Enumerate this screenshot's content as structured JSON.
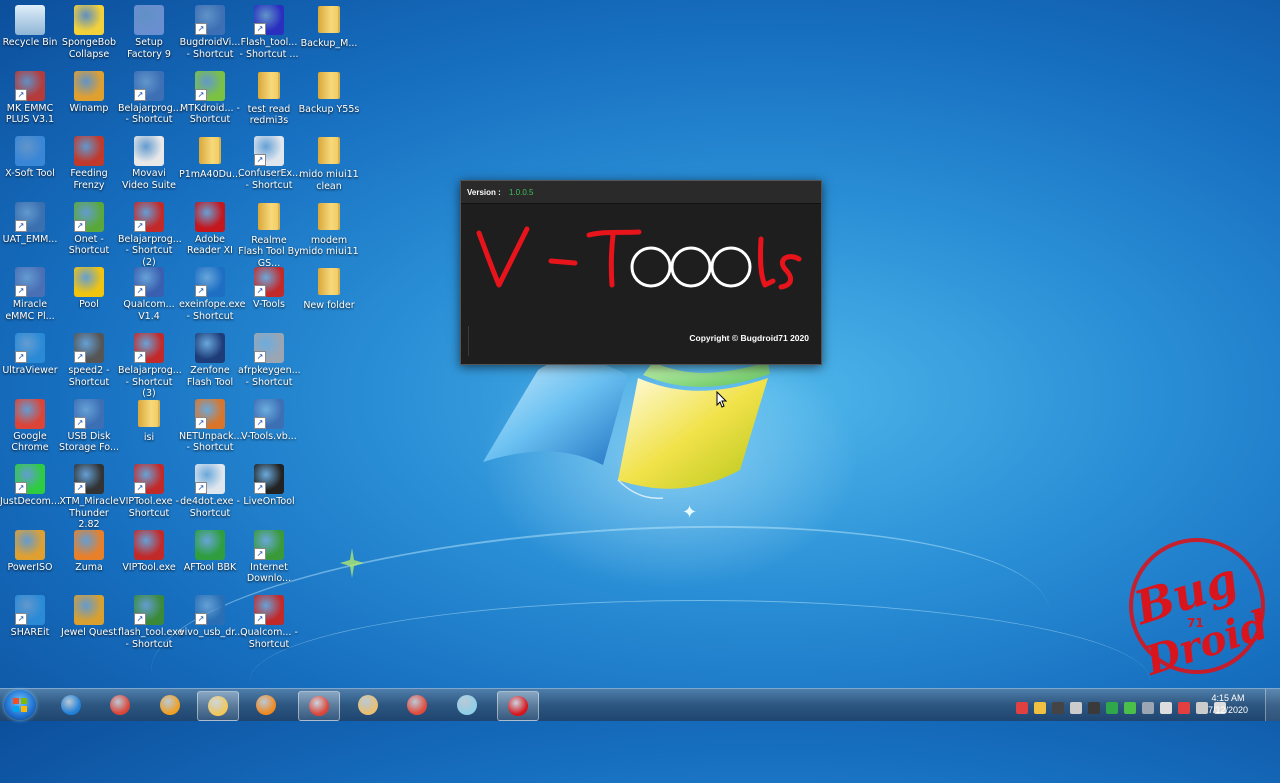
{
  "desktop_icons": [
    {
      "label": "Recycle Bin",
      "icon": "recycle-bin-icon",
      "kind": "bin",
      "color": "#8fb5d6"
    },
    {
      "label": "SpongeBob Collapse",
      "icon": "spongebob-icon",
      "kind": "app",
      "color": "#f3d13a"
    },
    {
      "label": "Setup Factory 9",
      "icon": "setup-factory-icon",
      "kind": "app",
      "color": "#6a8fd0"
    },
    {
      "label": "BugdroidVi... - Shortcut",
      "icon": "vb-project-icon",
      "kind": "shortcut",
      "color": "#3d6fb5"
    },
    {
      "label": "Flash_tool... - Shortcut ...",
      "icon": "flash-tool-icon",
      "kind": "shortcut",
      "color": "#2a2fbf"
    },
    {
      "label": "Backup_M...",
      "icon": "folder-icon",
      "kind": "folder"
    },
    {
      "label": "MK EMMC PLUS V3.1",
      "icon": "mk-emmc-icon",
      "kind": "shortcut",
      "color": "#b53a3a"
    },
    {
      "label": "Winamp",
      "icon": "winamp-icon",
      "kind": "app",
      "color": "#e0a030"
    },
    {
      "label": "Belajarprog... - Shortcut",
      "icon": "vb-project-icon",
      "kind": "shortcut",
      "color": "#3d6fb5"
    },
    {
      "label": "MTKdroid... - Shortcut",
      "icon": "android-icon",
      "kind": "shortcut",
      "color": "#7cc242"
    },
    {
      "label": "test read redmi3s",
      "icon": "folder-icon",
      "kind": "folder"
    },
    {
      "label": "Backup Y55s",
      "icon": "folder-icon",
      "kind": "folder"
    },
    {
      "label": "X-Soft Tool",
      "icon": "gear-icon",
      "kind": "app",
      "color": "#3a86d6"
    },
    {
      "label": "Feeding Frenzy",
      "icon": "fish-icon",
      "kind": "app",
      "color": "#c0392b"
    },
    {
      "label": "Movavi Video Suite",
      "icon": "movavi-icon",
      "kind": "app",
      "color": "#e8e8e8"
    },
    {
      "label": "P1mA40Du...",
      "icon": "folder-icon",
      "kind": "folder"
    },
    {
      "label": "ConfuserEx... - Shortcut",
      "icon": "confuser-icon",
      "kind": "shortcut",
      "color": "#dfe6ee"
    },
    {
      "label": "mido miui11 clean",
      "icon": "folder-icon",
      "kind": "folder"
    },
    {
      "label": "UAT_EMM...",
      "icon": "uat-emmc-icon",
      "kind": "shortcut",
      "color": "#3a6fb0"
    },
    {
      "label": "Onet - Shortcut",
      "icon": "onet-icon",
      "kind": "shortcut",
      "color": "#5aa83c"
    },
    {
      "label": "Belajarprog... - Shortcut (2)",
      "icon": "bug-icon",
      "kind": "shortcut",
      "color": "#c22a2a"
    },
    {
      "label": "Adobe Reader XI",
      "icon": "adobe-reader-icon",
      "kind": "app",
      "color": "#c4161c"
    },
    {
      "label": "Realme Flash Tool By GS...",
      "icon": "folder-icon",
      "kind": "folder"
    },
    {
      "label": "modem mido miui11",
      "icon": "folder-icon",
      "kind": "folder"
    },
    {
      "label": "Miracle eMMC Pl...",
      "icon": "miracle-icon",
      "kind": "shortcut",
      "color": "#4a6fb5"
    },
    {
      "label": "Pool",
      "icon": "pool-ball-icon",
      "kind": "app",
      "color": "#f1c40f"
    },
    {
      "label": "Qualcom... V1.4",
      "icon": "qualcomm-icon",
      "kind": "shortcut",
      "color": "#3a5fb0"
    },
    {
      "label": "exeinfope.exe - Shortcut",
      "icon": "exeinfo-icon",
      "kind": "shortcut",
      "color": "#1e6fc4"
    },
    {
      "label": "V-Tools",
      "icon": "bug-icon",
      "kind": "shortcut",
      "color": "#c22a2a"
    },
    {
      "label": "New folder",
      "icon": "folder-icon",
      "kind": "folder"
    },
    {
      "label": "UltraViewer",
      "icon": "ultraviewer-icon",
      "kind": "shortcut",
      "color": "#2a8ad6"
    },
    {
      "label": "speed2 - Shortcut",
      "icon": "speed-icon",
      "kind": "shortcut",
      "color": "#555555"
    },
    {
      "label": "Belajarprog... - Shortcut (3)",
      "icon": "bug-icon",
      "kind": "shortcut",
      "color": "#c22a2a"
    },
    {
      "label": "Zenfone Flash Tool",
      "icon": "zenfone-icon",
      "kind": "app",
      "color": "#1e3c78"
    },
    {
      "label": "afrpkeygen... - Shortcut",
      "icon": "tools-icon",
      "kind": "shortcut",
      "color": "#9aa6b4"
    },
    null,
    {
      "label": "Google Chrome",
      "icon": "chrome-icon",
      "kind": "app",
      "color": "#db4437"
    },
    {
      "label": "USB Disk Storage Fo...",
      "icon": "usb-icon",
      "kind": "shortcut",
      "color": "#3d6fb5"
    },
    {
      "label": "isi",
      "icon": "folder-icon",
      "kind": "folder"
    },
    {
      "label": "NETUnpack... - Shortcut",
      "icon": "netunpack-icon",
      "kind": "shortcut",
      "color": "#d8752a"
    },
    {
      "label": "V-Tools.vb...",
      "icon": "vb-project-icon",
      "kind": "shortcut",
      "color": "#3d6fb5"
    },
    null,
    {
      "label": "JustDecom...",
      "icon": "justdecompile-icon",
      "kind": "shortcut",
      "color": "#2ecc40"
    },
    {
      "label": "XTM_Miracle Thunder 2.82",
      "icon": "thunder-icon",
      "kind": "shortcut",
      "color": "#333333"
    },
    {
      "label": "VIPTool.exe - Shortcut",
      "icon": "bug-icon",
      "kind": "shortcut",
      "color": "#c22a2a"
    },
    {
      "label": "de4dot.exe - Shortcut",
      "icon": "de4dot-icon",
      "kind": "shortcut",
      "color": "#dfe6ee"
    },
    {
      "label": "LiveOnTool",
      "icon": "liveon-icon",
      "kind": "shortcut",
      "color": "#222222"
    },
    null,
    {
      "label": "PowerISO",
      "icon": "poweriso-icon",
      "kind": "app",
      "color": "#e0a030"
    },
    {
      "label": "Zuma",
      "icon": "zuma-icon",
      "kind": "app",
      "color": "#e8802a"
    },
    {
      "label": "VIPTool.exe",
      "icon": "bug-icon",
      "kind": "app",
      "color": "#c22a2a"
    },
    {
      "label": "AFTool BBK",
      "icon": "aftool-icon",
      "kind": "app",
      "color": "#2e9e3e"
    },
    {
      "label": "Internet Downlo...",
      "icon": "idm-icon",
      "kind": "shortcut",
      "color": "#3a9a3a"
    },
    null,
    {
      "label": "SHAREit",
      "icon": "shareit-icon",
      "kind": "shortcut",
      "color": "#2a8ad6"
    },
    {
      "label": "Jewel Quest",
      "icon": "jewel-quest-icon",
      "kind": "app",
      "color": "#d9a030"
    },
    {
      "label": "flash_tool.exe - Shortcut",
      "icon": "flash-tool-exe-icon",
      "kind": "shortcut",
      "color": "#3a8a3a"
    },
    {
      "label": "vivo_usb_dr...",
      "icon": "vivo-usb-icon",
      "kind": "shortcut",
      "color": "#2a6fb5"
    },
    {
      "label": "Qualcom... - Shortcut",
      "icon": "bug-icon",
      "kind": "shortcut",
      "color": "#c22a2a"
    }
  ],
  "splash": {
    "version_label": "Version :",
    "version_value": "1.0.0.5",
    "logo_text": "V-TOOLs",
    "copyright": "Copyright © Bugdroid71 2020"
  },
  "watermark": {
    "text": "Bug Droid",
    "small": "71",
    "color": "#d8141c"
  },
  "taskbar": {
    "pinned": [
      {
        "name": "internet-explorer-icon",
        "color": "#1f7fd6",
        "active": false
      },
      {
        "name": "chrome-icon",
        "color": "#db4437",
        "active": false
      },
      {
        "name": "sublime-icon",
        "color": "#f0a020",
        "active": false
      },
      {
        "name": "explorer-folder-icon",
        "color": "#f2c85a",
        "active": true
      },
      {
        "name": "media-player-icon",
        "color": "#f08a20",
        "active": false
      },
      {
        "name": "chrome-icon",
        "color": "#db4437",
        "active": true
      },
      {
        "name": "paint-icon",
        "color": "#e8c070",
        "active": false
      },
      {
        "name": "movavi-icon",
        "color": "#e34a3a",
        "active": false
      },
      {
        "name": "eraser-icon",
        "color": "#8fd0e8",
        "active": false
      },
      {
        "name": "vtools-app-icon",
        "color": "#d8141c",
        "active": true
      }
    ],
    "tray_icons": [
      "#e04040",
      "#f0c040",
      "#444444",
      "#cccccc",
      "#3a3a3a",
      "#2ea84a",
      "#4ac04a",
      "#9aa6b4",
      "#dddddd",
      "#e04040",
      "#cccccc",
      "#dddddd"
    ],
    "time": "4:15 AM",
    "date": "7/12/2020"
  }
}
